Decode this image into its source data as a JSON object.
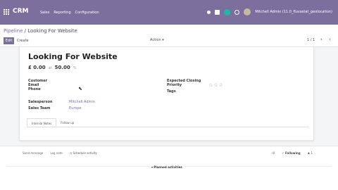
{
  "topbar": {
    "app_name": "CRM",
    "menu": [
      "Sales",
      "Reporting",
      "Configuration"
    ],
    "chat_count": "5",
    "user_name": "Mitchell Admin (11.0_fluvastat_geolocation)"
  },
  "control": {
    "breadcrumb_parent": "Pipeline",
    "breadcrumb_sep": "/",
    "breadcrumb_current": "Looking For Website",
    "edit_label": "Edit",
    "create_label": "Create",
    "action_label": "Action ▾",
    "pager": "1 / 1",
    "prev": "‹",
    "next": "›"
  },
  "lead": {
    "title": "Looking For Website",
    "revenue": "£ 0.00",
    "at": "at",
    "probability": "50.00",
    "pct": "%",
    "customer_label": "Customer",
    "email_label": "Email",
    "phone_label": "Phone",
    "closing_label": "Expected Closing",
    "priority_label": "Priority",
    "tags_label": "Tags",
    "salesperson_label": "Salesperson",
    "salesperson_value": "Mitchell Admin",
    "team_label": "Sales Team",
    "team_value": "Europe",
    "stars": "☆☆☆",
    "tabs": [
      "Internal Notes",
      "Follow up"
    ]
  },
  "chatter": {
    "send_message": "Send message",
    "log_note": "Log note",
    "schedule": "Schedule activity",
    "attachments": "0",
    "following": "Following",
    "followers": "1",
    "planned": "Planned activities"
  }
}
